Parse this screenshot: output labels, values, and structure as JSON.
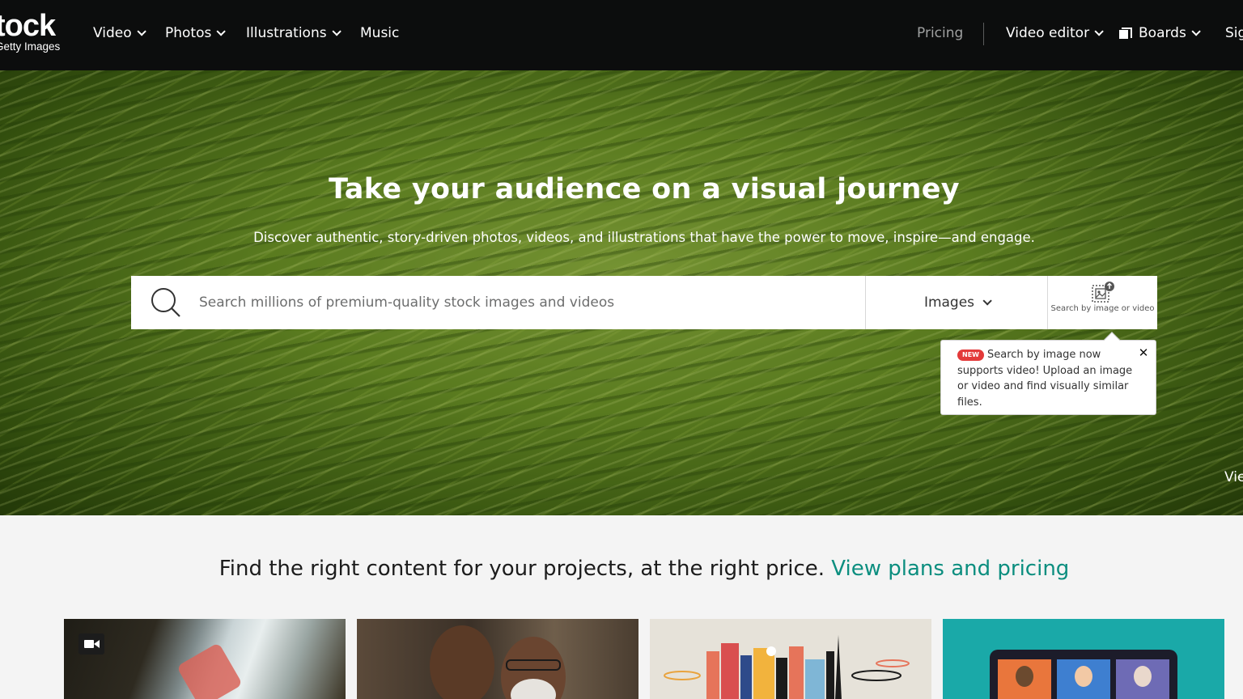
{
  "header": {
    "logo_main": "tock",
    "logo_sub": "Getty Images",
    "nav": [
      {
        "label": "Video"
      },
      {
        "label": "Photos"
      },
      {
        "label": "Illustrations"
      },
      {
        "label": "Music"
      }
    ],
    "pricing_label": "Pricing",
    "video_editor_label": "Video editor",
    "boards_label": "Boards",
    "signin_label": "Sig"
  },
  "hero": {
    "title": "Take your audience on a visual journey",
    "subtitle": "Discover authentic, story-driven photos, videos, and illustrations that have the power to move, inspire—and engage.",
    "corner_text": "Vie"
  },
  "search": {
    "placeholder": "Search millions of premium-quality stock images and videos",
    "type_label": "Images",
    "by_image_label": "Search by image or video"
  },
  "tooltip": {
    "badge": "NEW",
    "text": "Search by image now supports video! Upload an image or video and find visually similar files.",
    "close": "✕"
  },
  "pricing_banner": {
    "text": "Find the right content for your projects, at the right price. ",
    "link": "View plans and pricing"
  },
  "cards": [
    {
      "name": "video-card"
    },
    {
      "name": "photo-card"
    },
    {
      "name": "illustration-card"
    },
    {
      "name": "vector-card"
    }
  ]
}
